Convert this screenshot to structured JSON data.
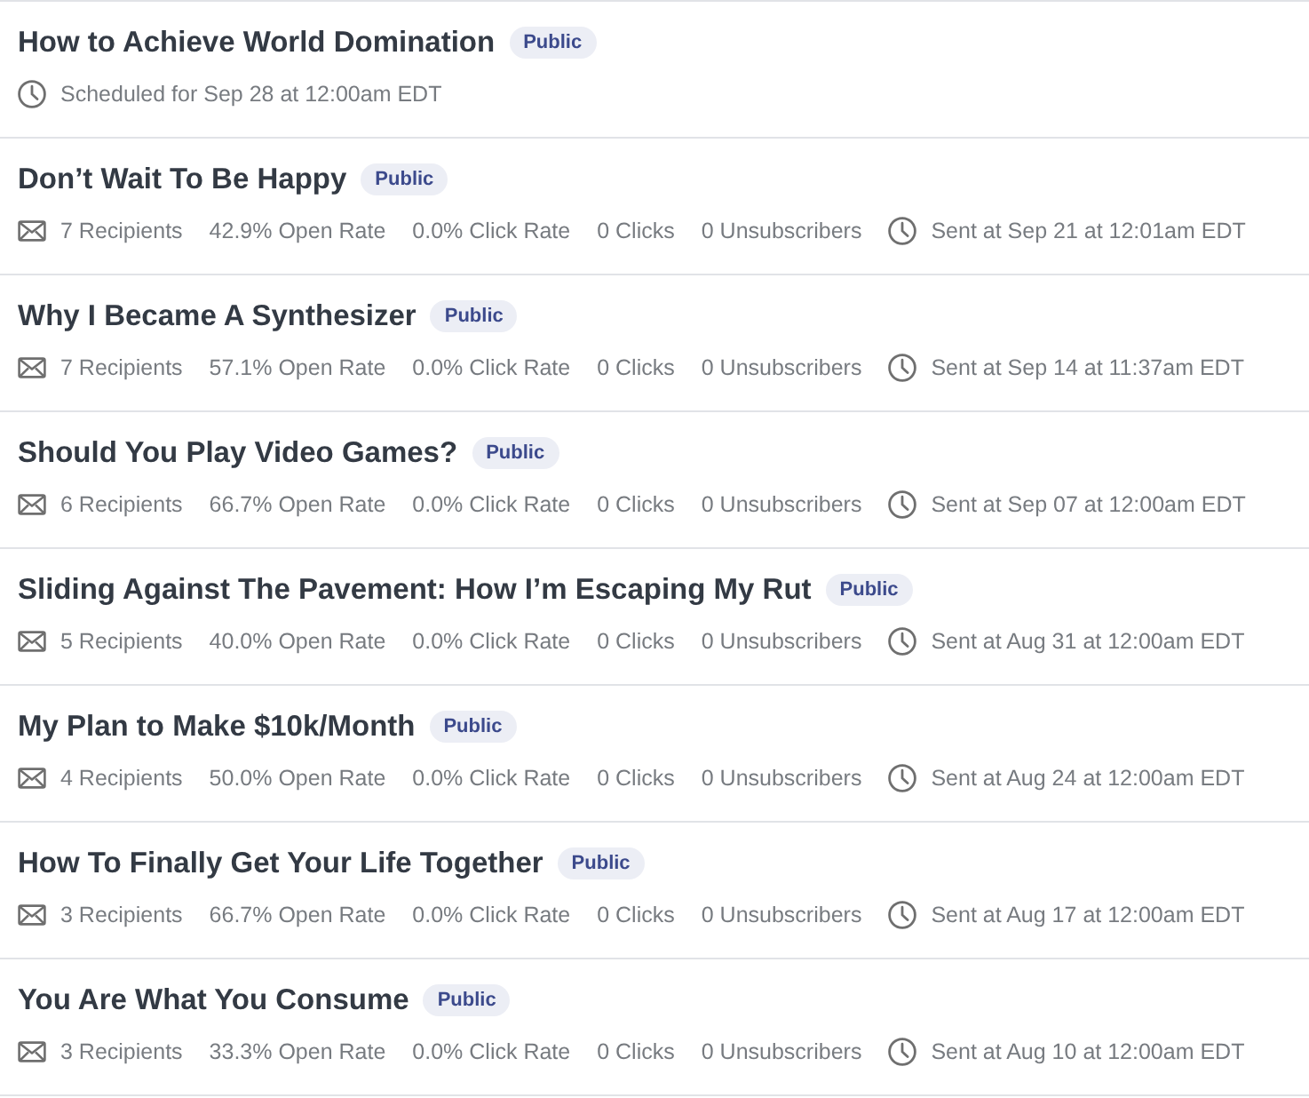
{
  "posts": [
    {
      "title": "How to Achieve World Domination",
      "badge": "Public",
      "metrics": [
        {
          "kind": "time",
          "text": "Scheduled for Sep 28 at 12:00am EDT"
        }
      ]
    },
    {
      "title": "Don’t Wait To Be Happy",
      "badge": "Public",
      "metrics": [
        {
          "kind": "recipients",
          "text": "7 Recipients"
        },
        {
          "kind": "open_rate",
          "text": "42.9% Open Rate"
        },
        {
          "kind": "click_rate",
          "text": "0.0% Click Rate"
        },
        {
          "kind": "clicks",
          "text": "0 Clicks"
        },
        {
          "kind": "unsubscribers",
          "text": "0 Unsubscribers"
        },
        {
          "kind": "time",
          "text": "Sent at Sep 21 at 12:01am EDT"
        }
      ]
    },
    {
      "title": "Why I Became A Synthesizer",
      "badge": "Public",
      "metrics": [
        {
          "kind": "recipients",
          "text": "7 Recipients"
        },
        {
          "kind": "open_rate",
          "text": "57.1% Open Rate"
        },
        {
          "kind": "click_rate",
          "text": "0.0% Click Rate"
        },
        {
          "kind": "clicks",
          "text": "0 Clicks"
        },
        {
          "kind": "unsubscribers",
          "text": "0 Unsubscribers"
        },
        {
          "kind": "time",
          "text": "Sent at Sep 14 at 11:37am EDT"
        }
      ]
    },
    {
      "title": "Should You Play Video Games?",
      "badge": "Public",
      "metrics": [
        {
          "kind": "recipients",
          "text": "6 Recipients"
        },
        {
          "kind": "open_rate",
          "text": "66.7% Open Rate"
        },
        {
          "kind": "click_rate",
          "text": "0.0% Click Rate"
        },
        {
          "kind": "clicks",
          "text": "0 Clicks"
        },
        {
          "kind": "unsubscribers",
          "text": "0 Unsubscribers"
        },
        {
          "kind": "time",
          "text": "Sent at Sep 07 at 12:00am EDT"
        }
      ]
    },
    {
      "title": "Sliding Against The Pavement: How I’m Escaping My Rut",
      "badge": "Public",
      "metrics": [
        {
          "kind": "recipients",
          "text": "5 Recipients"
        },
        {
          "kind": "open_rate",
          "text": "40.0% Open Rate"
        },
        {
          "kind": "click_rate",
          "text": "0.0% Click Rate"
        },
        {
          "kind": "clicks",
          "text": "0 Clicks"
        },
        {
          "kind": "unsubscribers",
          "text": "0 Unsubscribers"
        },
        {
          "kind": "time",
          "text": "Sent at Aug 31 at 12:00am EDT"
        }
      ]
    },
    {
      "title": "My Plan to Make $10k/Month",
      "badge": "Public",
      "metrics": [
        {
          "kind": "recipients",
          "text": "4 Recipients"
        },
        {
          "kind": "open_rate",
          "text": "50.0% Open Rate"
        },
        {
          "kind": "click_rate",
          "text": "0.0% Click Rate"
        },
        {
          "kind": "clicks",
          "text": "0 Clicks"
        },
        {
          "kind": "unsubscribers",
          "text": "0 Unsubscribers"
        },
        {
          "kind": "time",
          "text": "Sent at Aug 24 at 12:00am EDT"
        }
      ]
    },
    {
      "title": "How To Finally Get Your Life Together",
      "badge": "Public",
      "metrics": [
        {
          "kind": "recipients",
          "text": "3 Recipients"
        },
        {
          "kind": "open_rate",
          "text": "66.7% Open Rate"
        },
        {
          "kind": "click_rate",
          "text": "0.0% Click Rate"
        },
        {
          "kind": "clicks",
          "text": "0 Clicks"
        },
        {
          "kind": "unsubscribers",
          "text": "0 Unsubscribers"
        },
        {
          "kind": "time",
          "text": "Sent at Aug 17 at 12:00am EDT"
        }
      ]
    },
    {
      "title": "You Are What You Consume",
      "badge": "Public",
      "metrics": [
        {
          "kind": "recipients",
          "text": "3 Recipients"
        },
        {
          "kind": "open_rate",
          "text": "33.3% Open Rate"
        },
        {
          "kind": "click_rate",
          "text": "0.0% Click Rate"
        },
        {
          "kind": "clicks",
          "text": "0 Clicks"
        },
        {
          "kind": "unsubscribers",
          "text": "0 Unsubscribers"
        },
        {
          "kind": "time",
          "text": "Sent at Aug 10 at 12:00am EDT"
        }
      ]
    }
  ]
}
